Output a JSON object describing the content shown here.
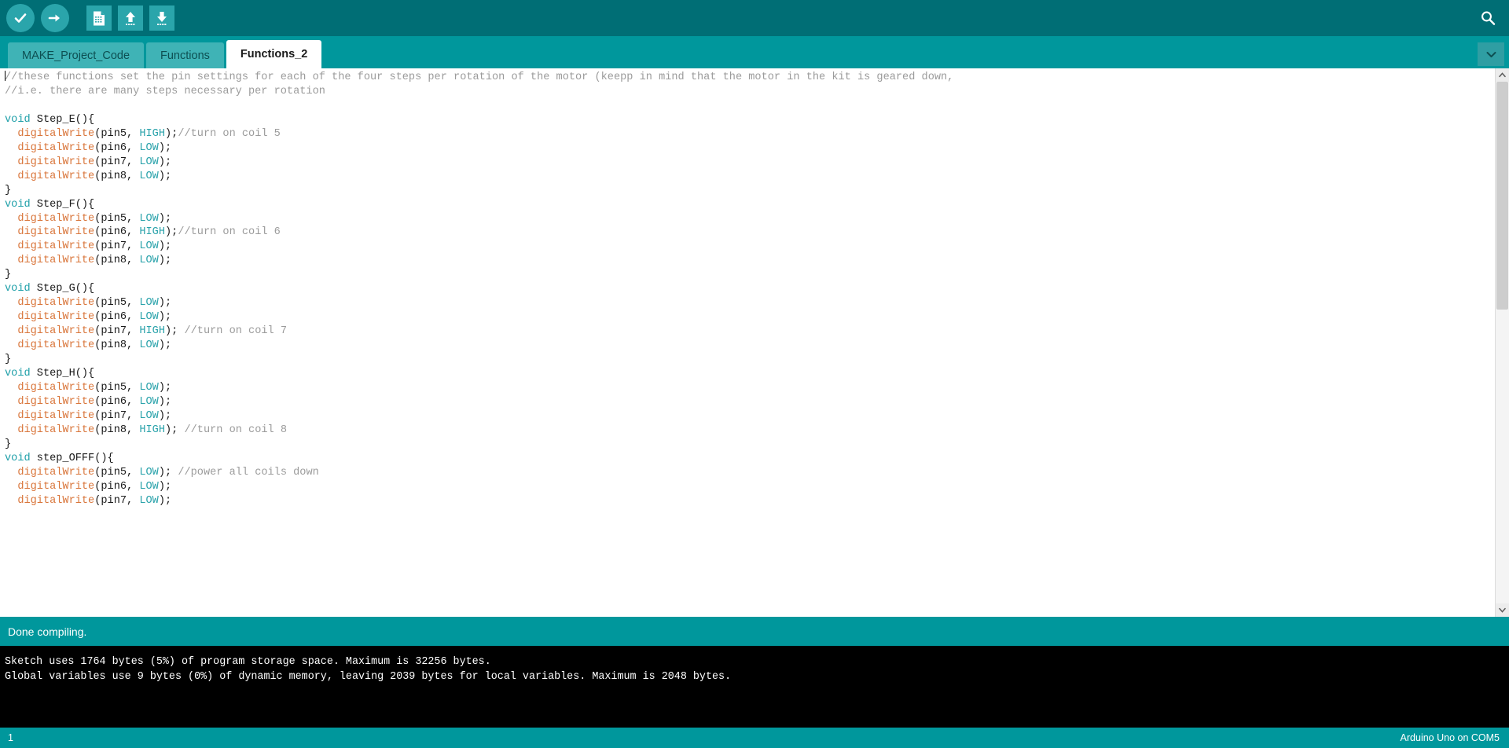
{
  "toolbar": {
    "buttons": [
      {
        "name": "verify-button",
        "icon": "check-icon",
        "title": "Verify"
      },
      {
        "name": "upload-button",
        "icon": "arrow-right-icon",
        "title": "Upload"
      },
      {
        "name": "new-button",
        "icon": "new-file-icon",
        "title": "New"
      },
      {
        "name": "open-button",
        "icon": "arrow-up-icon",
        "title": "Open"
      },
      {
        "name": "save-button",
        "icon": "arrow-down-icon",
        "title": "Save"
      }
    ],
    "serial_monitor": {
      "name": "serial-monitor-button",
      "icon": "magnifier-icon",
      "title": "Serial Monitor"
    },
    "colors": {
      "bar": "#006e75",
      "button": "#2aa5ab",
      "glyph": "#ffffff"
    }
  },
  "tabs": {
    "items": [
      {
        "label": "MAKE_Project_Code",
        "active": false
      },
      {
        "label": "Functions",
        "active": false
      },
      {
        "label": "Functions_2",
        "active": true
      }
    ],
    "menu_icon": "chevron-down-icon",
    "colors": {
      "bar": "#00979c",
      "inactive": "#3fb3b6",
      "active": "#ffffff"
    }
  },
  "editor": {
    "cursor_line": 1,
    "colors": {
      "comment": "#9b9b9b",
      "keyword": "#1d9fa8",
      "function": "#d9753a",
      "constant": "#2ba3ab",
      "plain": "#1a1a1a",
      "background": "#ffffff"
    },
    "lines": [
      {
        "tokens": [
          {
            "t": "cm",
            "v": "//these functions set the pin settings for each of the four steps per rotation of the motor (keepp in mind that the motor in the kit is geared down,"
          }
        ]
      },
      {
        "tokens": [
          {
            "t": "cm",
            "v": "//i.e. there are many steps necessary per rotation"
          }
        ]
      },
      {
        "tokens": []
      },
      {
        "tokens": [
          {
            "t": "kw",
            "v": "void"
          },
          {
            "t": "pl",
            "v": " Step_E(){"
          }
        ]
      },
      {
        "tokens": [
          {
            "t": "pl",
            "v": "  "
          },
          {
            "t": "fn",
            "v": "digitalWrite"
          },
          {
            "t": "pl",
            "v": "(pin5, "
          },
          {
            "t": "cn",
            "v": "HIGH"
          },
          {
            "t": "pl",
            "v": ");"
          },
          {
            "t": "cm",
            "v": "//turn on coil 5"
          }
        ]
      },
      {
        "tokens": [
          {
            "t": "pl",
            "v": "  "
          },
          {
            "t": "fn",
            "v": "digitalWrite"
          },
          {
            "t": "pl",
            "v": "(pin6, "
          },
          {
            "t": "cn",
            "v": "LOW"
          },
          {
            "t": "pl",
            "v": ");"
          }
        ]
      },
      {
        "tokens": [
          {
            "t": "pl",
            "v": "  "
          },
          {
            "t": "fn",
            "v": "digitalWrite"
          },
          {
            "t": "pl",
            "v": "(pin7, "
          },
          {
            "t": "cn",
            "v": "LOW"
          },
          {
            "t": "pl",
            "v": ");"
          }
        ]
      },
      {
        "tokens": [
          {
            "t": "pl",
            "v": "  "
          },
          {
            "t": "fn",
            "v": "digitalWrite"
          },
          {
            "t": "pl",
            "v": "(pin8, "
          },
          {
            "t": "cn",
            "v": "LOW"
          },
          {
            "t": "pl",
            "v": ");"
          }
        ]
      },
      {
        "tokens": [
          {
            "t": "pl",
            "v": "}"
          }
        ]
      },
      {
        "tokens": [
          {
            "t": "kw",
            "v": "void"
          },
          {
            "t": "pl",
            "v": " Step_F(){"
          }
        ]
      },
      {
        "tokens": [
          {
            "t": "pl",
            "v": "  "
          },
          {
            "t": "fn",
            "v": "digitalWrite"
          },
          {
            "t": "pl",
            "v": "(pin5, "
          },
          {
            "t": "cn",
            "v": "LOW"
          },
          {
            "t": "pl",
            "v": ");"
          }
        ]
      },
      {
        "tokens": [
          {
            "t": "pl",
            "v": "  "
          },
          {
            "t": "fn",
            "v": "digitalWrite"
          },
          {
            "t": "pl",
            "v": "(pin6, "
          },
          {
            "t": "cn",
            "v": "HIGH"
          },
          {
            "t": "pl",
            "v": ");"
          },
          {
            "t": "cm",
            "v": "//turn on coil 6"
          }
        ]
      },
      {
        "tokens": [
          {
            "t": "pl",
            "v": "  "
          },
          {
            "t": "fn",
            "v": "digitalWrite"
          },
          {
            "t": "pl",
            "v": "(pin7, "
          },
          {
            "t": "cn",
            "v": "LOW"
          },
          {
            "t": "pl",
            "v": ");"
          }
        ]
      },
      {
        "tokens": [
          {
            "t": "pl",
            "v": "  "
          },
          {
            "t": "fn",
            "v": "digitalWrite"
          },
          {
            "t": "pl",
            "v": "(pin8, "
          },
          {
            "t": "cn",
            "v": "LOW"
          },
          {
            "t": "pl",
            "v": ");"
          }
        ]
      },
      {
        "tokens": [
          {
            "t": "pl",
            "v": "}"
          }
        ]
      },
      {
        "tokens": [
          {
            "t": "kw",
            "v": "void"
          },
          {
            "t": "pl",
            "v": " Step_G(){"
          }
        ]
      },
      {
        "tokens": [
          {
            "t": "pl",
            "v": "  "
          },
          {
            "t": "fn",
            "v": "digitalWrite"
          },
          {
            "t": "pl",
            "v": "(pin5, "
          },
          {
            "t": "cn",
            "v": "LOW"
          },
          {
            "t": "pl",
            "v": ");"
          }
        ]
      },
      {
        "tokens": [
          {
            "t": "pl",
            "v": "  "
          },
          {
            "t": "fn",
            "v": "digitalWrite"
          },
          {
            "t": "pl",
            "v": "(pin6, "
          },
          {
            "t": "cn",
            "v": "LOW"
          },
          {
            "t": "pl",
            "v": ");"
          }
        ]
      },
      {
        "tokens": [
          {
            "t": "pl",
            "v": "  "
          },
          {
            "t": "fn",
            "v": "digitalWrite"
          },
          {
            "t": "pl",
            "v": "(pin7, "
          },
          {
            "t": "cn",
            "v": "HIGH"
          },
          {
            "t": "pl",
            "v": "); "
          },
          {
            "t": "cm",
            "v": "//turn on coil 7"
          }
        ]
      },
      {
        "tokens": [
          {
            "t": "pl",
            "v": "  "
          },
          {
            "t": "fn",
            "v": "digitalWrite"
          },
          {
            "t": "pl",
            "v": "(pin8, "
          },
          {
            "t": "cn",
            "v": "LOW"
          },
          {
            "t": "pl",
            "v": ");"
          }
        ]
      },
      {
        "tokens": [
          {
            "t": "pl",
            "v": "}"
          }
        ]
      },
      {
        "tokens": [
          {
            "t": "kw",
            "v": "void"
          },
          {
            "t": "pl",
            "v": " Step_H(){"
          }
        ]
      },
      {
        "tokens": [
          {
            "t": "pl",
            "v": "  "
          },
          {
            "t": "fn",
            "v": "digitalWrite"
          },
          {
            "t": "pl",
            "v": "(pin5, "
          },
          {
            "t": "cn",
            "v": "LOW"
          },
          {
            "t": "pl",
            "v": ");"
          }
        ]
      },
      {
        "tokens": [
          {
            "t": "pl",
            "v": "  "
          },
          {
            "t": "fn",
            "v": "digitalWrite"
          },
          {
            "t": "pl",
            "v": "(pin6, "
          },
          {
            "t": "cn",
            "v": "LOW"
          },
          {
            "t": "pl",
            "v": ");"
          }
        ]
      },
      {
        "tokens": [
          {
            "t": "pl",
            "v": "  "
          },
          {
            "t": "fn",
            "v": "digitalWrite"
          },
          {
            "t": "pl",
            "v": "(pin7, "
          },
          {
            "t": "cn",
            "v": "LOW"
          },
          {
            "t": "pl",
            "v": ");"
          }
        ]
      },
      {
        "tokens": [
          {
            "t": "pl",
            "v": "  "
          },
          {
            "t": "fn",
            "v": "digitalWrite"
          },
          {
            "t": "pl",
            "v": "(pin8, "
          },
          {
            "t": "cn",
            "v": "HIGH"
          },
          {
            "t": "pl",
            "v": "); "
          },
          {
            "t": "cm",
            "v": "//turn on coil 8"
          }
        ]
      },
      {
        "tokens": [
          {
            "t": "pl",
            "v": "}"
          }
        ]
      },
      {
        "tokens": [
          {
            "t": "kw",
            "v": "void"
          },
          {
            "t": "pl",
            "v": " step_OFFF(){"
          }
        ]
      },
      {
        "tokens": [
          {
            "t": "pl",
            "v": "  "
          },
          {
            "t": "fn",
            "v": "digitalWrite"
          },
          {
            "t": "pl",
            "v": "(pin5, "
          },
          {
            "t": "cn",
            "v": "LOW"
          },
          {
            "t": "pl",
            "v": "); "
          },
          {
            "t": "cm",
            "v": "//power all coils down"
          }
        ]
      },
      {
        "tokens": [
          {
            "t": "pl",
            "v": "  "
          },
          {
            "t": "fn",
            "v": "digitalWrite"
          },
          {
            "t": "pl",
            "v": "(pin6, "
          },
          {
            "t": "cn",
            "v": "LOW"
          },
          {
            "t": "pl",
            "v": ");"
          }
        ]
      },
      {
        "tokens": [
          {
            "t": "pl",
            "v": "  "
          },
          {
            "t": "fn",
            "v": "digitalWrite"
          },
          {
            "t": "pl",
            "v": "(pin7, "
          },
          {
            "t": "cn",
            "v": "LOW"
          },
          {
            "t": "pl",
            "v": ");"
          }
        ]
      }
    ]
  },
  "status": {
    "message": "Done compiling.",
    "background": "#00979c"
  },
  "console": {
    "lines": [
      "Sketch uses 1764 bytes (5%) of program storage space. Maximum is 32256 bytes.",
      "Global variables use 9 bytes (0%) of dynamic memory, leaving 2039 bytes for local variables. Maximum is 2048 bytes."
    ],
    "background": "#000000"
  },
  "footer": {
    "line_number": "1",
    "board": "Arduino Uno on COM5",
    "background": "#00979c"
  }
}
